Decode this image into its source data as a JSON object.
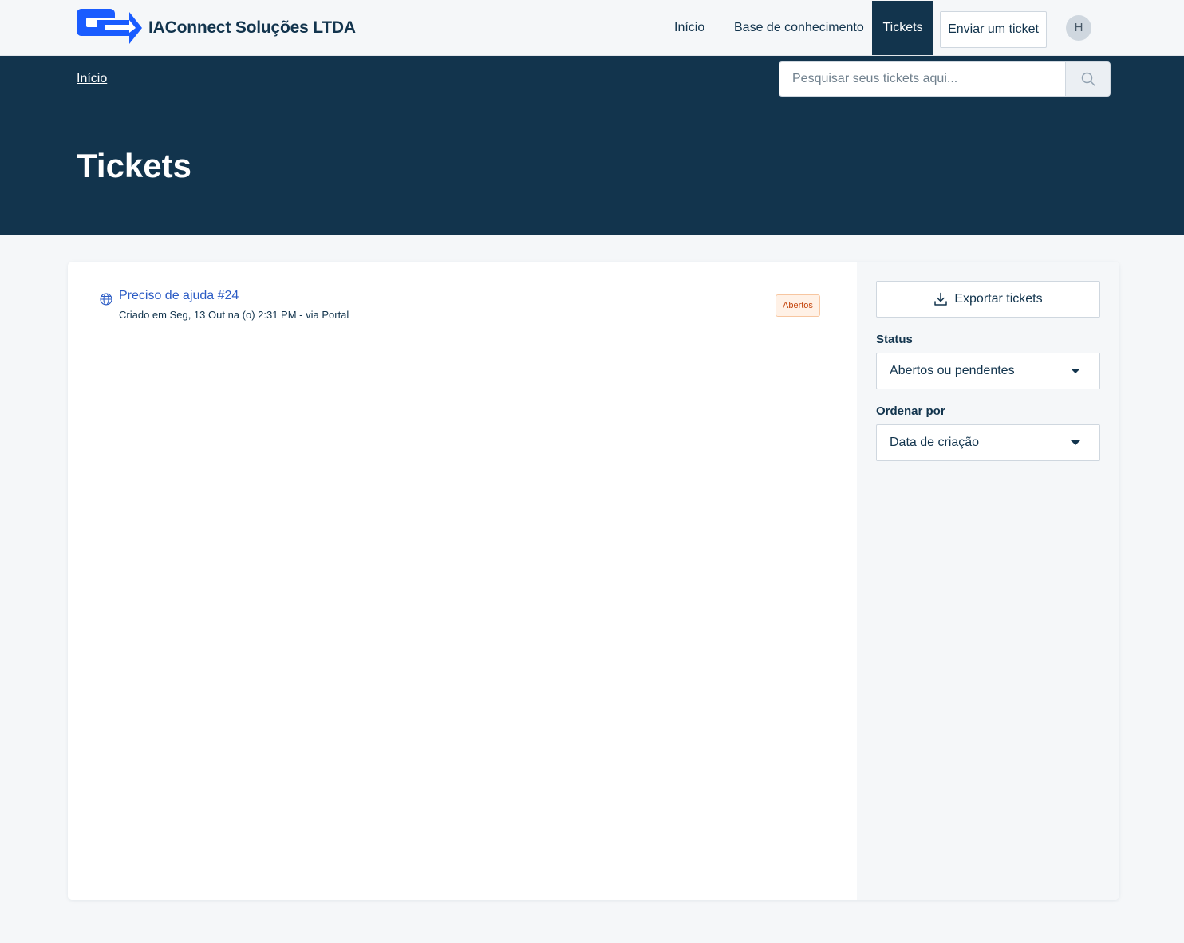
{
  "header": {
    "brand": "IAConnect Soluções LTDA",
    "logo_icon": "iaconnect-logo",
    "nav": {
      "inicio": "Início",
      "base": "Base de conhecimento",
      "tickets": "Tickets",
      "send_ticket": "Enviar um ticket"
    },
    "avatar_initial": "H"
  },
  "hero": {
    "breadcrumb": "Início",
    "search": {
      "placeholder": "Pesquisar seus tickets aqui...",
      "icon": "search-icon"
    },
    "title": "Tickets"
  },
  "tickets": [
    {
      "icon": "globe-icon",
      "title": "Preciso de ajuda #24",
      "meta": "Criado em Seg, 13 Out na (o) 2:31 PM - via Portal",
      "status": "Abertos"
    }
  ],
  "sidebar": {
    "export_label": "Exportar tickets",
    "export_icon": "download-icon",
    "status_label": "Status",
    "status_value": "Abertos ou pendentes",
    "order_label": "Ordenar por",
    "order_value": "Data de criação"
  },
  "colors": {
    "primary": "#12344d",
    "link": "#2c5cc5",
    "logo": "#1a5cff",
    "badge_bg": "#fff1e6",
    "badge_text": "#c4440c",
    "background": "#f5f7f9"
  }
}
